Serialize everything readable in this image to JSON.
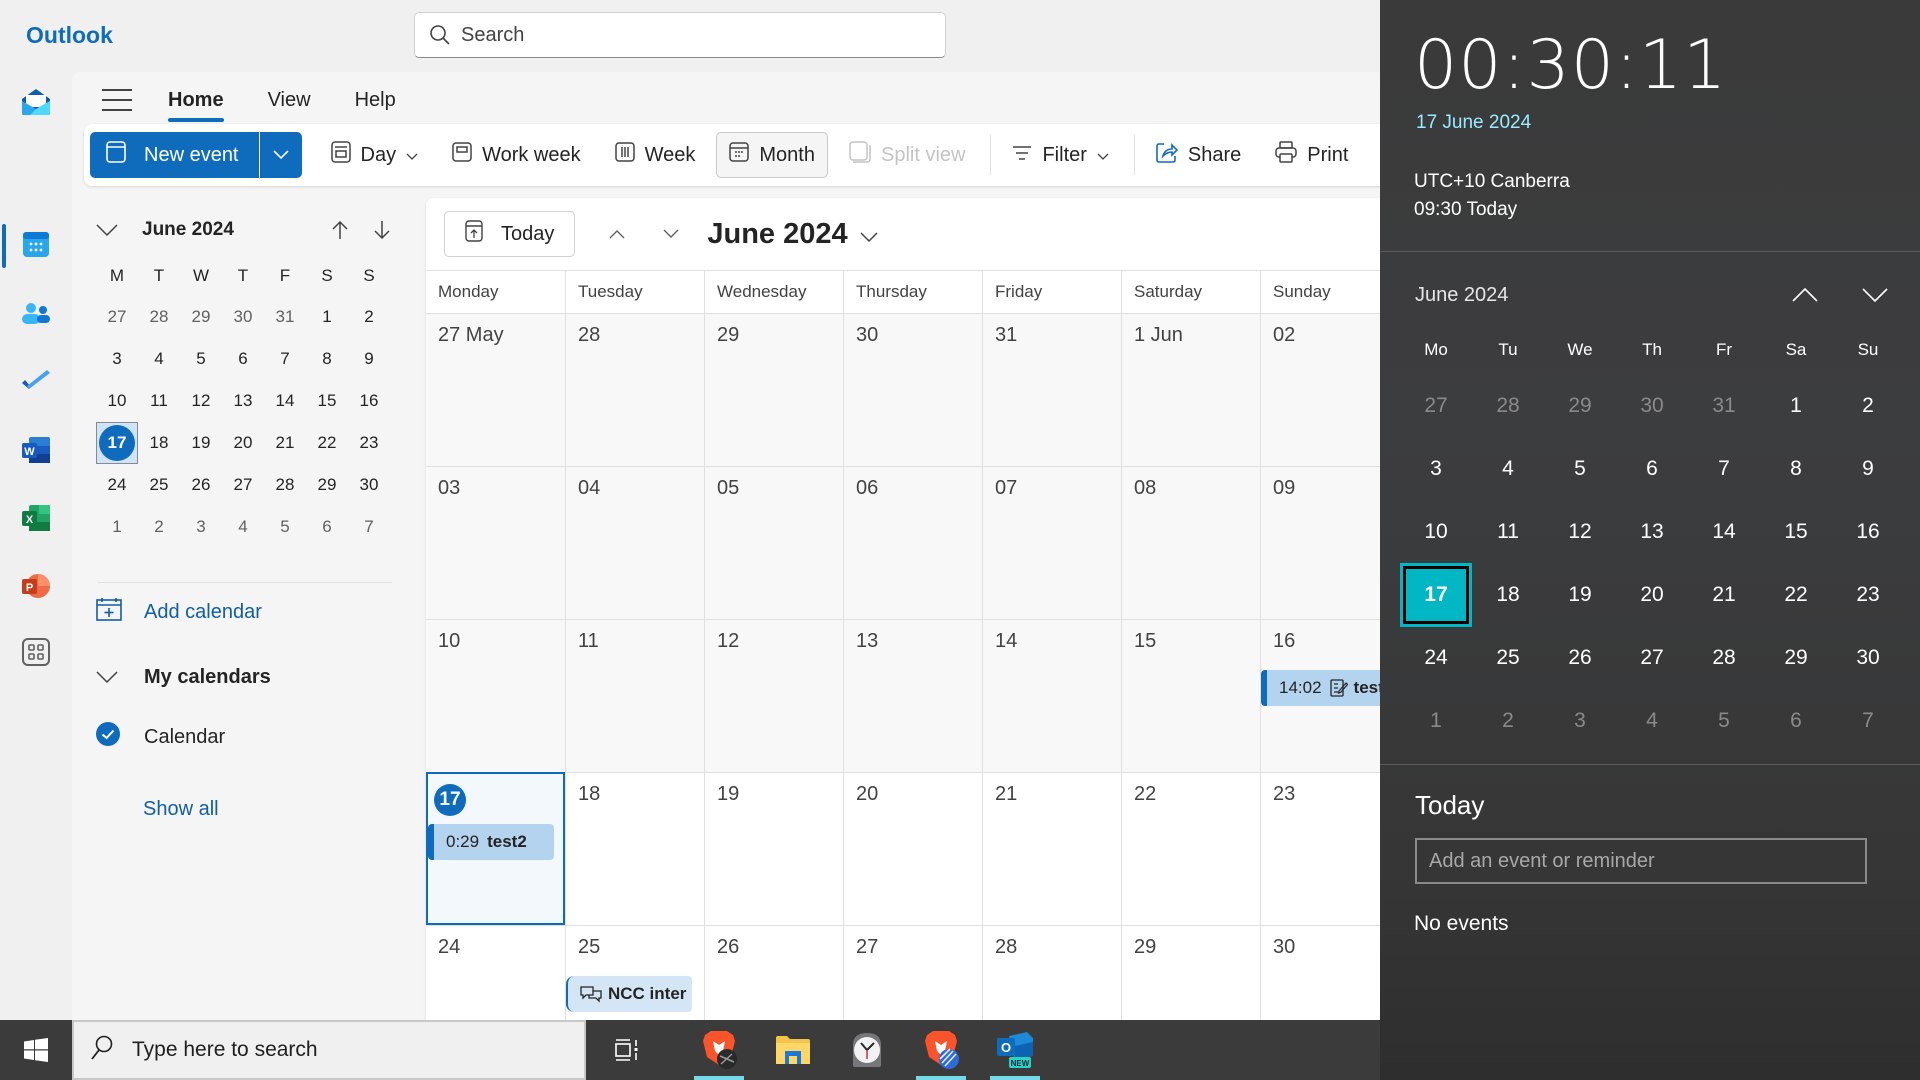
{
  "app": {
    "title": "Outlook",
    "search_placeholder": "Search"
  },
  "menu": {
    "tabs": [
      {
        "label": "Home",
        "active": true
      },
      {
        "label": "View",
        "active": false
      },
      {
        "label": "Help",
        "active": false
      }
    ]
  },
  "ribbon": {
    "new_event": "New event",
    "day": "Day",
    "work_week": "Work week",
    "week": "Week",
    "month": "Month",
    "split_view": "Split view",
    "filter": "Filter",
    "share": "Share",
    "print": "Print"
  },
  "mini_calendar": {
    "title": "June 2024",
    "weekdays": [
      "M",
      "T",
      "W",
      "T",
      "F",
      "S",
      "S"
    ],
    "weeks": [
      [
        {
          "d": "27",
          "o": true
        },
        {
          "d": "28",
          "o": true
        },
        {
          "d": "29",
          "o": true
        },
        {
          "d": "30",
          "o": true
        },
        {
          "d": "31",
          "o": true
        },
        {
          "d": "1"
        },
        {
          "d": "2"
        }
      ],
      [
        {
          "d": "3"
        },
        {
          "d": "4"
        },
        {
          "d": "5"
        },
        {
          "d": "6"
        },
        {
          "d": "7"
        },
        {
          "d": "8"
        },
        {
          "d": "9"
        }
      ],
      [
        {
          "d": "10"
        },
        {
          "d": "11"
        },
        {
          "d": "12"
        },
        {
          "d": "13"
        },
        {
          "d": "14"
        },
        {
          "d": "15"
        },
        {
          "d": "16"
        }
      ],
      [
        {
          "d": "17",
          "today": true
        },
        {
          "d": "18"
        },
        {
          "d": "19"
        },
        {
          "d": "20"
        },
        {
          "d": "21"
        },
        {
          "d": "22"
        },
        {
          "d": "23"
        }
      ],
      [
        {
          "d": "24"
        },
        {
          "d": "25"
        },
        {
          "d": "26"
        },
        {
          "d": "27"
        },
        {
          "d": "28"
        },
        {
          "d": "29"
        },
        {
          "d": "30"
        }
      ],
      [
        {
          "d": "1",
          "o": true
        },
        {
          "d": "2",
          "o": true
        },
        {
          "d": "3",
          "o": true
        },
        {
          "d": "4",
          "o": true
        },
        {
          "d": "5",
          "o": true
        },
        {
          "d": "6",
          "o": true
        },
        {
          "d": "7",
          "o": true
        }
      ]
    ]
  },
  "sidebar": {
    "add_calendar": "Add calendar",
    "my_calendars": "My calendars",
    "calendar_item": "Calendar",
    "show_all": "Show all"
  },
  "month_view": {
    "today_button": "Today",
    "title": "June 2024",
    "weekdays": [
      "Monday",
      "Tuesday",
      "Wednesday",
      "Thursday",
      "Friday",
      "Saturday",
      "Sunday"
    ],
    "weeks": [
      {
        "current": false,
        "days": [
          "27 May",
          "28",
          "29",
          "30",
          "31",
          "1 Jun",
          "02"
        ]
      },
      {
        "current": false,
        "days": [
          "03",
          "04",
          "05",
          "06",
          "07",
          "08",
          "09"
        ]
      },
      {
        "current": false,
        "days": [
          "10",
          "11",
          "12",
          "13",
          "14",
          "15",
          "16"
        ]
      },
      {
        "current": true,
        "days": [
          "17",
          "18",
          "19",
          "20",
          "21",
          "22",
          "23"
        ]
      },
      {
        "current": true,
        "days": [
          "24",
          "25",
          "26",
          "27",
          "28",
          "29",
          "30"
        ]
      }
    ],
    "today_cell": {
      "week": 3,
      "day": 0
    },
    "events": [
      {
        "week": 2,
        "day": 6,
        "time": "14:02",
        "title": "test",
        "icon": "notes-icon",
        "style": "solid"
      },
      {
        "week": 3,
        "day": 0,
        "time": "0:29",
        "title": "test2",
        "icon": "",
        "style": "solid"
      },
      {
        "week": 4,
        "day": 1,
        "time": "",
        "title": "NCC inter",
        "icon": "chat-icon",
        "style": "light"
      }
    ]
  },
  "flyout": {
    "clock": "00:30:11",
    "date": "17 June 2024",
    "timezone": "UTC+10 Canberra",
    "tz_time": "09:30 Today",
    "calendar_title": "June 2024",
    "weekdays": [
      "Mo",
      "Tu",
      "We",
      "Th",
      "Fr",
      "Sa",
      "Su"
    ],
    "weeks": [
      [
        {
          "d": "27",
          "o": true
        },
        {
          "d": "28",
          "o": true
        },
        {
          "d": "29",
          "o": true
        },
        {
          "d": "30",
          "o": true
        },
        {
          "d": "31",
          "o": true
        },
        {
          "d": "1"
        },
        {
          "d": "2"
        }
      ],
      [
        {
          "d": "3"
        },
        {
          "d": "4"
        },
        {
          "d": "5"
        },
        {
          "d": "6"
        },
        {
          "d": "7"
        },
        {
          "d": "8"
        },
        {
          "d": "9"
        }
      ],
      [
        {
          "d": "10"
        },
        {
          "d": "11"
        },
        {
          "d": "12"
        },
        {
          "d": "13"
        },
        {
          "d": "14"
        },
        {
          "d": "15"
        },
        {
          "d": "16"
        }
      ],
      [
        {
          "d": "17",
          "today": true
        },
        {
          "d": "18"
        },
        {
          "d": "19"
        },
        {
          "d": "20"
        },
        {
          "d": "21"
        },
        {
          "d": "22"
        },
        {
          "d": "23"
        }
      ],
      [
        {
          "d": "24"
        },
        {
          "d": "25"
        },
        {
          "d": "26"
        },
        {
          "d": "27"
        },
        {
          "d": "28"
        },
        {
          "d": "29"
        },
        {
          "d": "30"
        }
      ],
      [
        {
          "d": "1",
          "o": true
        },
        {
          "d": "2",
          "o": true
        },
        {
          "d": "3",
          "o": true
        },
        {
          "d": "4",
          "o": true
        },
        {
          "d": "5",
          "o": true
        },
        {
          "d": "6",
          "o": true
        },
        {
          "d": "7",
          "o": true
        }
      ]
    ],
    "today_label": "Today",
    "add_event_placeholder": "Add an event or reminder",
    "no_events": "No events"
  },
  "taskbar": {
    "search_placeholder": "Type here to search",
    "apps": [
      {
        "name": "task-view",
        "running": false
      },
      {
        "name": "brave-browser",
        "running": true
      },
      {
        "name": "file-explorer",
        "running": false
      },
      {
        "name": "alarms-clock",
        "running": false
      },
      {
        "name": "brave-browser-2",
        "running": true
      },
      {
        "name": "outlook-new",
        "running": true
      }
    ]
  },
  "colors": {
    "accent": "#0f6cbd",
    "flyout_accent": "#00b7c3",
    "flyout_date": "#99ebff"
  }
}
